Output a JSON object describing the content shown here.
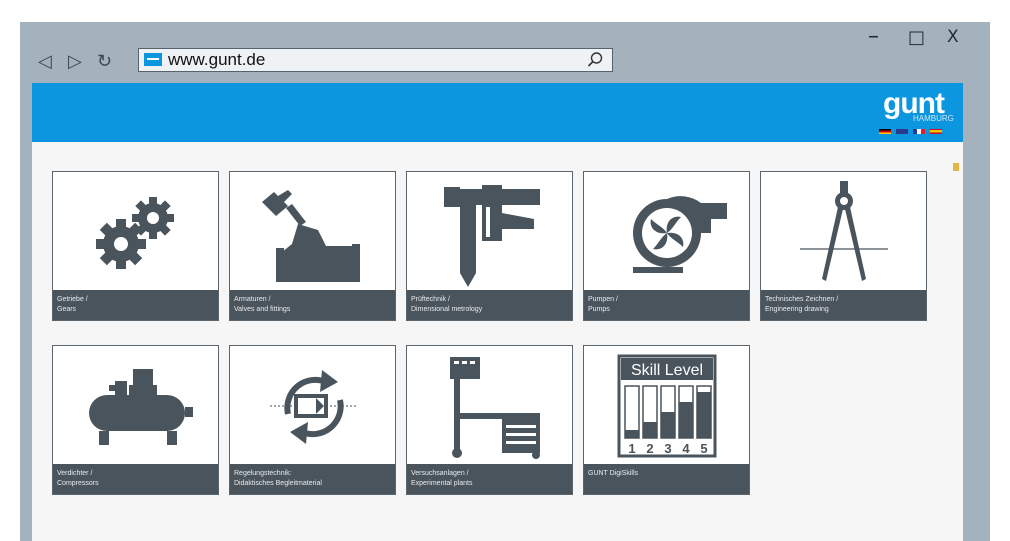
{
  "window": {
    "minimize_label": "–",
    "maximize_label": "□",
    "close_label": "X"
  },
  "browser": {
    "back_icon": "back-icon",
    "forward_icon": "forward-icon",
    "reload_icon": "reload-icon",
    "url": "www.gunt.de"
  },
  "header": {
    "logo_text": "gunt",
    "logo_sub": "HAMBURG",
    "accent": "#0b96df"
  },
  "tiles": [
    {
      "line1": "Getriebe /",
      "line2": "Gears",
      "icon": "gears-icon"
    },
    {
      "line1": "Armaturen /",
      "line2": "Valves and fittings",
      "icon": "valve-icon"
    },
    {
      "line1": "Prüftechnik /",
      "line2": "Dimensional metrology",
      "icon": "caliper-icon"
    },
    {
      "line1": "Pumpen /",
      "line2": "Pumps",
      "icon": "pump-icon"
    },
    {
      "line1": "Technisches Zeichnen /",
      "line2": "Engineering drawing",
      "icon": "compass-icon"
    },
    {
      "line1": "Verdichter /",
      "line2": "Compressors",
      "icon": "compressor-icon"
    },
    {
      "line1": "Regelungstechnik:",
      "line2": "Didaktisches Begleitmaterial",
      "icon": "control-loop-icon"
    },
    {
      "line1": "Versuchsanlagen /",
      "line2": "Experimental plants",
      "icon": "lab-bench-icon"
    },
    {
      "line1": "GUNT DigiSkills",
      "line2": "",
      "icon": "skill-level-icon"
    }
  ],
  "skill": {
    "title": "Skill Level",
    "levels": [
      "1",
      "2",
      "3",
      "4",
      "5"
    ]
  }
}
